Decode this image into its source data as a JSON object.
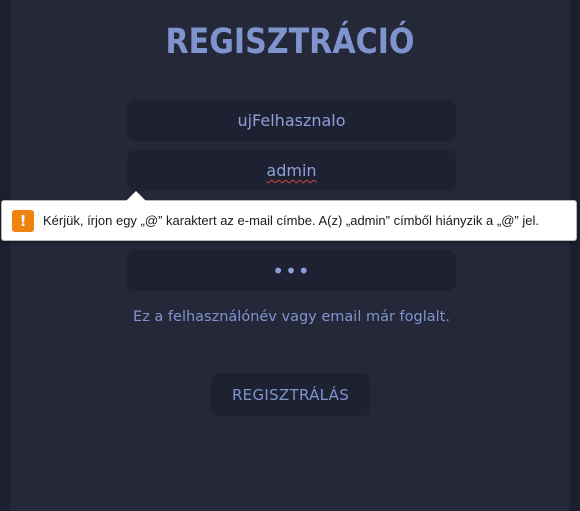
{
  "form": {
    "title": "REGISZTRÁCIÓ",
    "username_value": "ujFelhasznalo",
    "email_value": "admin",
    "password_value": "•••",
    "error_message": "Ez a felhasználónév vagy email már foglalt.",
    "submit_label": "REGISZTRÁLÁS"
  },
  "validation_tooltip": {
    "icon": "warning-icon",
    "icon_glyph": "!",
    "message": "Kérjük, írjon egy „@” karaktert az e-mail címbe. A(z) „admin” címből hiányzik a „@” jel."
  },
  "colors": {
    "background": "#1c1f2e",
    "panel": "#252839",
    "field": "#1e2131",
    "accent": "#7f93cf",
    "warning": "#f0820e"
  }
}
